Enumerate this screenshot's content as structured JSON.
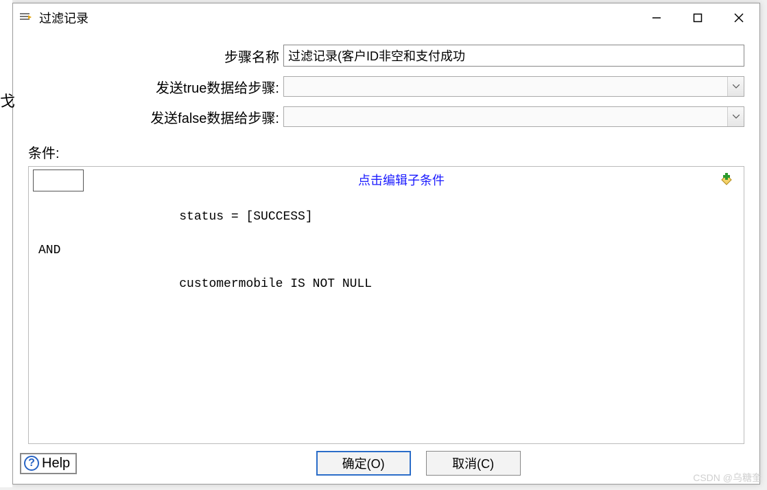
{
  "window": {
    "title": "过滤记录"
  },
  "form": {
    "stepNameLabel": "步骤名称",
    "stepName": "过滤记录(客户ID非空和支付成功",
    "trueLabel": "发送true数据给步骤:",
    "trueTarget": "",
    "falseLabel": "发送false数据给步骤:",
    "falseTarget": ""
  },
  "conditions": {
    "label": "条件:",
    "editLink": "点击编辑子条件",
    "lines": {
      "l1": "                   status = [SUCCESS]",
      "l2": "AND",
      "l3": "                   customermobile IS NOT NULL"
    }
  },
  "footer": {
    "help": "Help",
    "ok": "确定(O)",
    "cancel": "取消(C)"
  },
  "watermark": "CSDN @乌糖奎",
  "leftEdge": "戈"
}
